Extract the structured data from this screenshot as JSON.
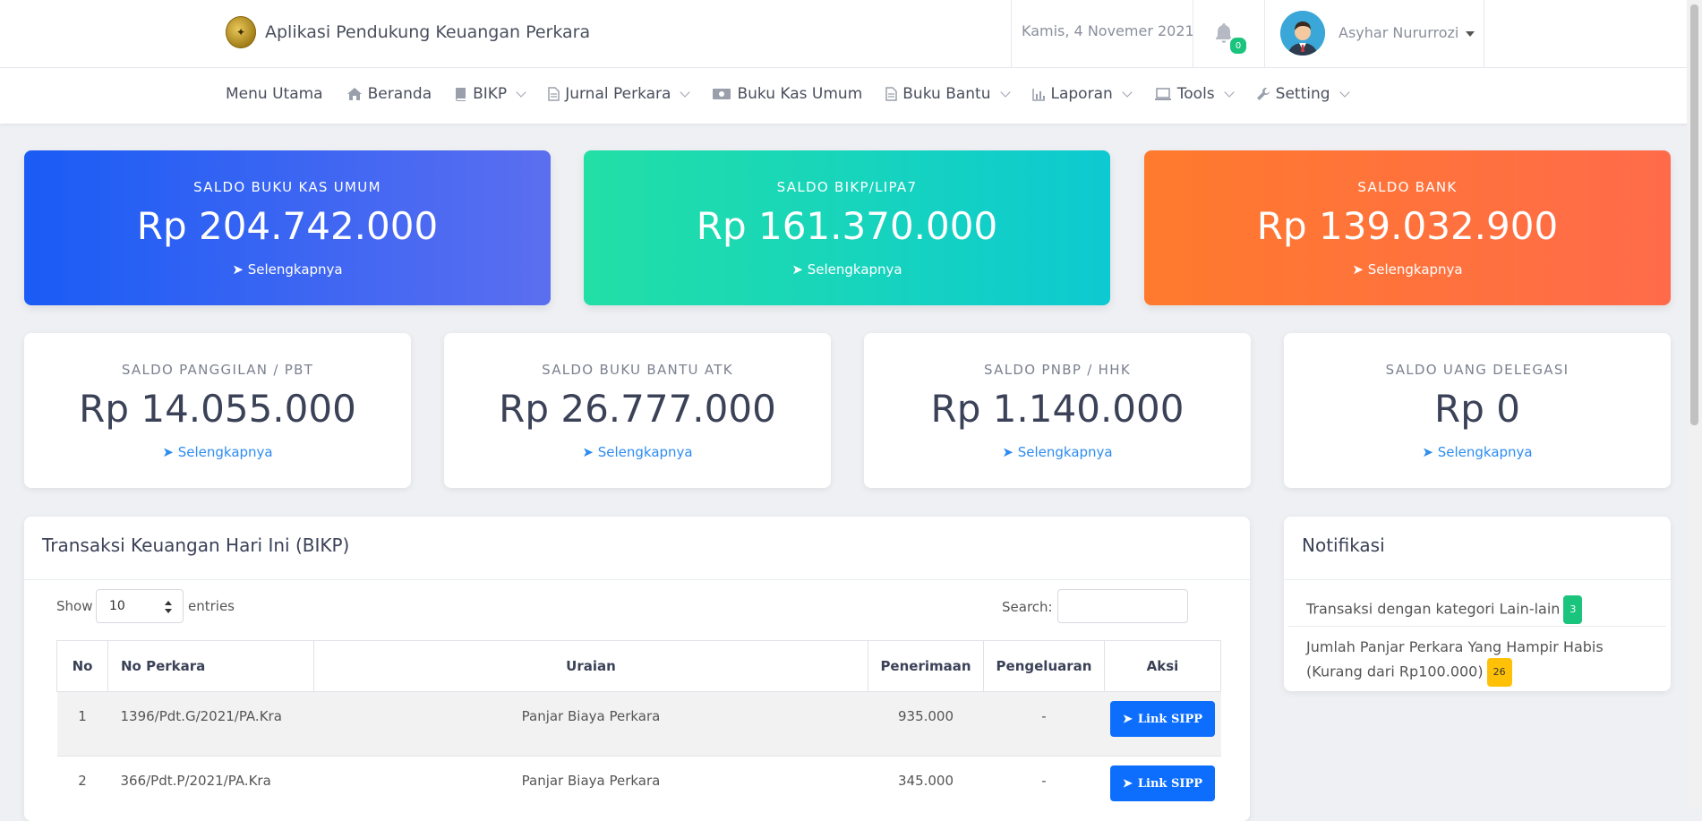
{
  "header": {
    "app_title": "Aplikasi Pendukung Keuangan Perkara",
    "date": "Kamis, 4 Novemer 2021",
    "notification_count": "0",
    "user_name": "Asyhar Nururrozi"
  },
  "nav": {
    "items": [
      {
        "label": "Menu Utama",
        "icon": "",
        "dropdown": false
      },
      {
        "label": "Beranda",
        "icon": "home-icon",
        "dropdown": false
      },
      {
        "label": "BIKP",
        "icon": "book-icon",
        "dropdown": true
      },
      {
        "label": "Jurnal Perkara",
        "icon": "file-icon",
        "dropdown": true
      },
      {
        "label": "Buku Kas Umum",
        "icon": "money-icon",
        "dropdown": false
      },
      {
        "label": "Buku Bantu",
        "icon": "file-icon",
        "dropdown": true
      },
      {
        "label": "Laporan",
        "icon": "bar-chart-icon",
        "dropdown": true
      },
      {
        "label": "Tools",
        "icon": "laptop-icon",
        "dropdown": true
      },
      {
        "label": "Setting",
        "icon": "wrench-icon",
        "dropdown": true
      }
    ]
  },
  "cards_top": [
    {
      "title": "SALDO BUKU KAS UMUM",
      "value": "Rp 204.742.000",
      "link": "Selengkapnya",
      "gradient": [
        "#1a5cf5",
        "#5b6ef0"
      ]
    },
    {
      "title": "SALDO BIKP/LIPA7",
      "value": "Rp 161.370.000",
      "link": "Selengkapnya",
      "gradient": [
        "#22dfa6",
        "#0dcad1"
      ]
    },
    {
      "title": "SALDO BANK",
      "value": "Rp 139.032.900",
      "link": "Selengkapnya",
      "gradient": [
        "#ff7a2d",
        "#ff6b4a"
      ]
    }
  ],
  "cards_bottom": [
    {
      "title": "SALDO PANGGILAN / PBT",
      "value": "Rp 14.055.000",
      "link": "Selengkapnya"
    },
    {
      "title": "SALDO BUKU BANTU ATK",
      "value": "Rp 26.777.000",
      "link": "Selengkapnya"
    },
    {
      "title": "SALDO PNBP / HHK",
      "value": "Rp 1.140.000",
      "link": "Selengkapnya"
    },
    {
      "title": "SALDO UANG DELEGASI",
      "value": "Rp 0",
      "link": "Selengkapnya"
    }
  ],
  "transactions": {
    "title": "Transaksi Keuangan Hari Ini (BIKP)",
    "show_label": "Show",
    "entries_value": "10",
    "entries_label": "entries",
    "search_label": "Search:",
    "columns": [
      "No",
      "No Perkara",
      "Uraian",
      "Penerimaan",
      "Pengeluaran",
      "Aksi"
    ],
    "rows": [
      {
        "no": "1",
        "perkara": "1396/Pdt.G/2021/PA.Kra",
        "uraian": "Panjar Biaya Perkara",
        "penerimaan": "935.000",
        "pengeluaran": "-",
        "aksi": "Link SIPP"
      },
      {
        "no": "2",
        "perkara": "366/Pdt.P/2021/PA.Kra",
        "uraian": "Panjar Biaya Perkara",
        "penerimaan": "345.000",
        "pengeluaran": "-",
        "aksi": "Link SIPP"
      }
    ]
  },
  "notifications": {
    "title": "Notifikasi",
    "items": [
      {
        "text": "Transaksi dengan kategori Lain-lain",
        "count": "3",
        "color": "#1bc47d"
      },
      {
        "text": "Jumlah Panjar Perkara Yang Hampir Habis (Kurang dari Rp100.000)",
        "count": "26",
        "color": "#ffc107"
      }
    ]
  }
}
